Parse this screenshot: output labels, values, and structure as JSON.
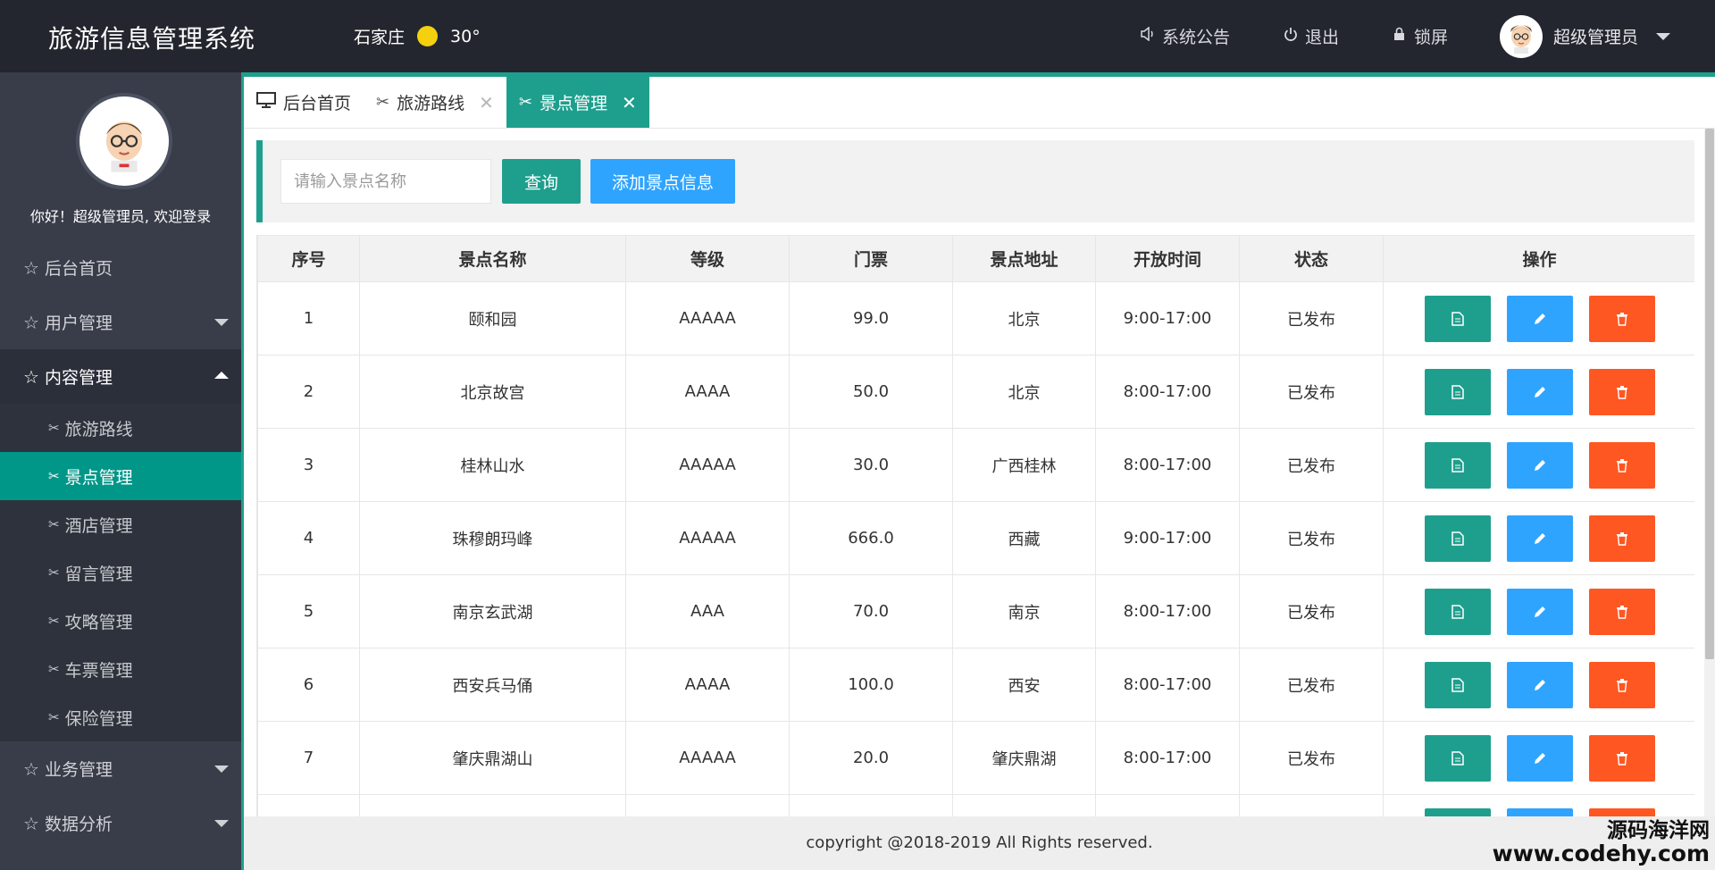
{
  "header": {
    "logo": "旅游信息管理系统",
    "city": "石家庄",
    "temperature": "30°",
    "notice_label": "系统公告",
    "logout_label": "退出",
    "lock_label": "锁屏",
    "user_name": "超级管理员"
  },
  "sidebar": {
    "welcome": "你好！超级管理员, 欢迎登录",
    "items": [
      {
        "label": "后台首页"
      },
      {
        "label": "用户管理"
      },
      {
        "label": "内容管理"
      },
      {
        "label": "业务管理"
      },
      {
        "label": "数据分析"
      }
    ],
    "sub_items": [
      {
        "label": "旅游路线"
      },
      {
        "label": "景点管理"
      },
      {
        "label": "酒店管理"
      },
      {
        "label": "留言管理"
      },
      {
        "label": "攻略管理"
      },
      {
        "label": "车票管理"
      },
      {
        "label": "保险管理"
      }
    ]
  },
  "tabs": [
    {
      "label": "后台首页"
    },
    {
      "label": "旅游路线"
    },
    {
      "label": "景点管理"
    }
  ],
  "toolbar": {
    "search_placeholder": "请输入景点名称",
    "query_label": "查询",
    "add_label": "添加景点信息"
  },
  "table": {
    "headers": [
      "序号",
      "景点名称",
      "等级",
      "门票",
      "景点地址",
      "开放时间",
      "状态",
      "操作"
    ],
    "rows": [
      [
        "1",
        "颐和园",
        "AAAAA",
        "99.0",
        "北京",
        "9:00-17:00",
        "已发布"
      ],
      [
        "2",
        "北京故宫",
        "AAAA",
        "50.0",
        "北京",
        "8:00-17:00",
        "已发布"
      ],
      [
        "3",
        "桂林山水",
        "AAAAA",
        "30.0",
        "广西桂林",
        "8:00-17:00",
        "已发布"
      ],
      [
        "4",
        "珠穆朗玛峰",
        "AAAAA",
        "666.0",
        "西藏",
        "9:00-17:00",
        "已发布"
      ],
      [
        "5",
        "南京玄武湖",
        "AAA",
        "70.0",
        "南京",
        "8:00-17:00",
        "已发布"
      ],
      [
        "6",
        "西安兵马俑",
        "AAAA",
        "100.0",
        "西安",
        "8:00-17:00",
        "已发布"
      ],
      [
        "7",
        "肇庆鼎湖山",
        "AAAAA",
        "20.0",
        "肇庆鼎湖",
        "8:00-17:00",
        "已发布"
      ]
    ]
  },
  "footer": {
    "copyright": "copyright @2018-2019 All Rights reserved."
  },
  "watermark": {
    "line1": "源码海洋网",
    "line2": "www.codehy.com"
  },
  "colors": {
    "header_bg": "#23262e",
    "sidebar_bg": "#393d49",
    "accent_teal": "#1e9f8e",
    "button_blue": "#2fa4ff",
    "button_red": "#ff5722"
  },
  "icons": {
    "notice": "speaker-icon",
    "logout": "power-icon",
    "lock": "lock-icon",
    "menu_parent": "star-icon",
    "menu_child": "tools-icon",
    "view": "document-icon",
    "edit": "pencil-icon",
    "delete": "trash-icon"
  }
}
